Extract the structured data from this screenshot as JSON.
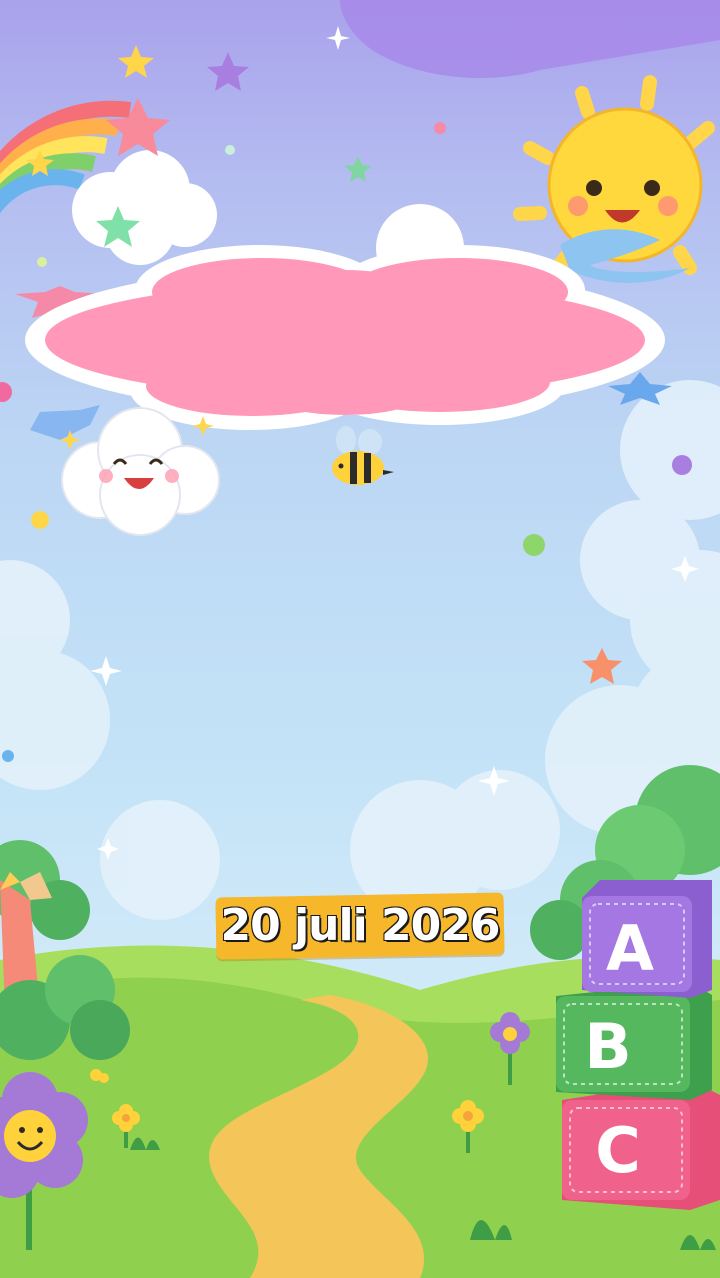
{
  "event": {
    "date": "20 juli 2026"
  },
  "blocks": {
    "letters": [
      "A",
      "B",
      "C"
    ]
  },
  "colors": {
    "sky_top": "#a9a2ec",
    "sky_bottom": "#d8eefa",
    "title_cloud": "#ff98b9",
    "date_badge": "#f6b72a",
    "grass": "#8fd14f",
    "path": "#f4c65a"
  }
}
